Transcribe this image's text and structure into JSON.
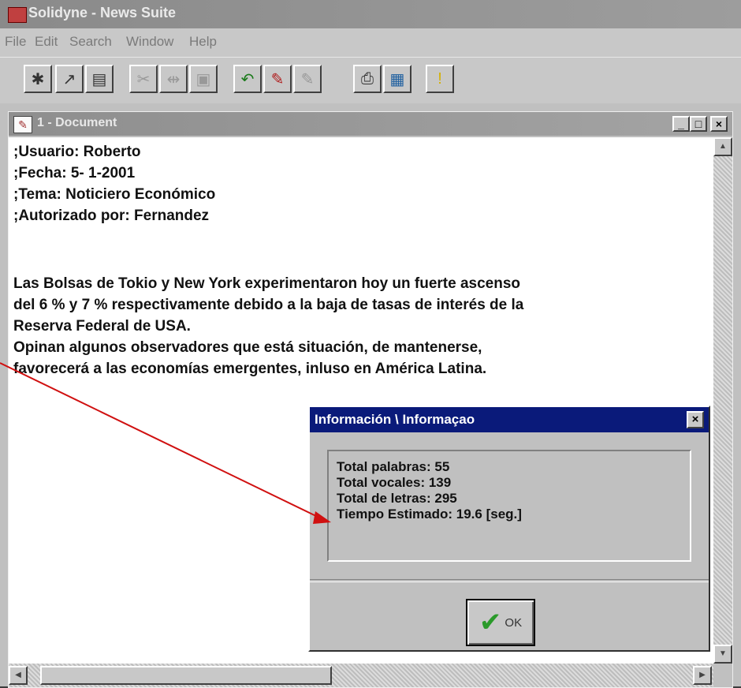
{
  "app": {
    "title": "Solidyne - News Suite",
    "menu": [
      "File",
      "Edit",
      "Search",
      "Window",
      "Help"
    ]
  },
  "toolbar": {
    "buttons": [
      "new-document-icon",
      "open-icon",
      "save-icon",
      "cut-icon",
      "paste-icon",
      "copy-icon",
      "undo-icon",
      "mark-icon",
      "highlight-icon",
      "print-icon",
      "statistics-icon",
      "info-icon"
    ]
  },
  "document": {
    "title": "1 - Document",
    "lines": [
      ";Usuario: Roberto",
      ";Fecha:  5- 1-2001",
      ";Tema: Noticiero Económico",
      ";Autorizado por: Fernandez",
      "Las Bolsas de Tokio y New York experimentaron hoy un fuerte ascenso",
      "del 6 % y 7 % respectivamente debido a la baja de tasas de interés de la",
      "Reserva Federal de USA.",
      "Opinan algunos observadores que está situación, de mantenerse,",
      "favorecerá a las economías emergentes, inluso en América Latina."
    ],
    "controls": {
      "minimize": "_",
      "maximize": "□",
      "close": "×"
    }
  },
  "dialog": {
    "title": "Información \\ Informaçao",
    "close": "×",
    "stats": [
      "Total palabras:   55",
      "Total vocales:  139",
      "Total de letras:  295",
      "Tiempo Estimado: 19.6 [seg.]"
    ],
    "ok_label": "OK"
  },
  "colors": {
    "dialog_title_bg": "#0a1a7a",
    "arrow": "#d01010",
    "ok_check": "#2a9a2a"
  }
}
